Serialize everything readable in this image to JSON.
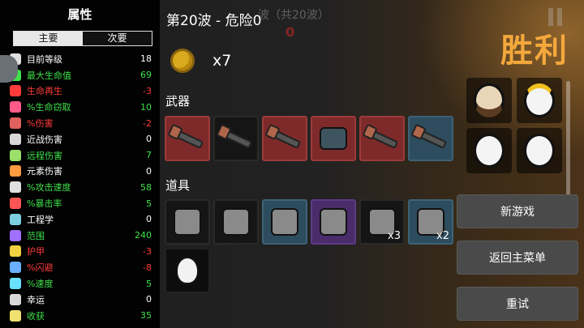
{
  "background": {
    "ghost_title": "波（共20波）",
    "ghost_number": "0"
  },
  "stats": {
    "title": "属性",
    "tabs": [
      "主要",
      "次要"
    ],
    "active_tab": "主要",
    "rows": [
      {
        "label": "目前等级",
        "value": "18",
        "value_color": "white",
        "label_color": "white",
        "icon": "level-icon"
      },
      {
        "label": "最大生命值",
        "value": "69",
        "value_color": "green",
        "label_color": "green",
        "icon": "heart-icon"
      },
      {
        "label": "生命再生",
        "value": "-3",
        "value_color": "red",
        "label_color": "red",
        "icon": "regen-icon"
      },
      {
        "label": "%生命窃取",
        "value": "10",
        "value_color": "green",
        "label_color": "green",
        "icon": "lifesteal-icon"
      },
      {
        "label": "%伤害",
        "value": "-2",
        "value_color": "red",
        "label_color": "red",
        "icon": "damage-icon"
      },
      {
        "label": "近战伤害",
        "value": "0",
        "value_color": "white",
        "label_color": "white",
        "icon": "melee-icon"
      },
      {
        "label": "远程伤害",
        "value": "7",
        "value_color": "green",
        "label_color": "green",
        "icon": "ranged-icon"
      },
      {
        "label": "元素伤害",
        "value": "0",
        "value_color": "white",
        "label_color": "white",
        "icon": "elemental-icon"
      },
      {
        "label": "%攻击速度",
        "value": "58",
        "value_color": "green",
        "label_color": "green",
        "icon": "attack-speed-icon"
      },
      {
        "label": "%暴击率",
        "value": "5",
        "value_color": "green",
        "label_color": "green",
        "icon": "crit-icon"
      },
      {
        "label": "工程学",
        "value": "0",
        "value_color": "white",
        "label_color": "white",
        "icon": "engineering-icon"
      },
      {
        "label": "范围",
        "value": "240",
        "value_color": "green",
        "label_color": "green",
        "icon": "range-icon"
      },
      {
        "label": "护甲",
        "value": "-3",
        "value_color": "red",
        "label_color": "red",
        "icon": "armor-icon"
      },
      {
        "label": "%闪避",
        "value": "-8",
        "value_color": "red",
        "label_color": "red",
        "icon": "dodge-icon"
      },
      {
        "label": "%速度",
        "value": "5",
        "value_color": "green",
        "label_color": "green",
        "icon": "speed-icon"
      },
      {
        "label": "幸运",
        "value": "0",
        "value_color": "white",
        "label_color": "white",
        "icon": "luck-icon"
      },
      {
        "label": "收获",
        "value": "35",
        "value_color": "green",
        "label_color": "green",
        "icon": "harvest-icon"
      }
    ]
  },
  "main": {
    "wave_title": "第20波 - 危险0",
    "coin_count": "x7",
    "weapons_label": "武器",
    "items_label": "道具",
    "weapons": [
      {
        "name": "shotgun-weapon",
        "bg": "red"
      },
      {
        "name": "shotgun-weapon",
        "bg": "gray"
      },
      {
        "name": "shotgun-weapon",
        "bg": "red"
      },
      {
        "name": "minigun-weapon",
        "bg": "red"
      },
      {
        "name": "shotgun-weapon",
        "bg": "red"
      },
      {
        "name": "shotgun-weapon",
        "bg": "blue"
      }
    ],
    "items": [
      {
        "name": "coffee-item",
        "bg": "gray",
        "qty": ""
      },
      {
        "name": "tongue-item",
        "bg": "gray",
        "qty": ""
      },
      {
        "name": "spyglass-item",
        "bg": "blue",
        "qty": ""
      },
      {
        "name": "mushroom-item",
        "bg": "purple",
        "qty": ""
      },
      {
        "name": "fox-item",
        "bg": "gray",
        "qty": "x3"
      },
      {
        "name": "potion-item",
        "bg": "blue",
        "qty": "x2"
      },
      {
        "name": "blob-item",
        "bg": "dark",
        "qty": ""
      }
    ]
  },
  "victory": {
    "title": "胜利",
    "characters": [
      "bearded-character",
      "crowned-character",
      "egg-character",
      "egg-smug-character"
    ]
  },
  "buttons": {
    "new_game": "新游戏",
    "main_menu": "返回主菜单",
    "retry": "重试"
  },
  "colors": {
    "accent_orange": "#f4a83c",
    "stat_green": "#3ee04a",
    "stat_red": "#ff3b3b"
  }
}
